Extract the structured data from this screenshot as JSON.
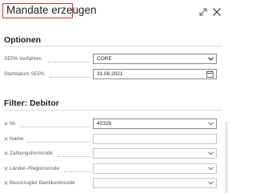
{
  "dialog": {
    "title": "Mandate erzeugen"
  },
  "optionen": {
    "heading": "Optionen",
    "fields": [
      {
        "label": "SEPA-Verfahren",
        "value": "CORE",
        "control": "dropdown"
      },
      {
        "label": "Startdatum SEPA",
        "value": "31.08.2021",
        "control": "date"
      }
    ]
  },
  "filter": {
    "heading": "Filter: Debitor",
    "fields": [
      {
        "label": "Nr.",
        "value": "40326"
      },
      {
        "label": "Name",
        "value": ""
      },
      {
        "label": "Zahlungsformcode",
        "value": ""
      },
      {
        "label": "Länder-/Regionscode",
        "value": ""
      },
      {
        "label": "Bevorzugter Bankkontocode",
        "value": ""
      }
    ]
  },
  "icons": {
    "expand": "expand-icon",
    "close": "close-icon",
    "chevron": "chevron-down-icon",
    "calendar": "calendar-icon",
    "remove_filter": "remove-filter-icon"
  },
  "colors": {
    "title_highlight": "#d92d2d",
    "label": "#605e5c",
    "field_border": "#8a8886"
  }
}
